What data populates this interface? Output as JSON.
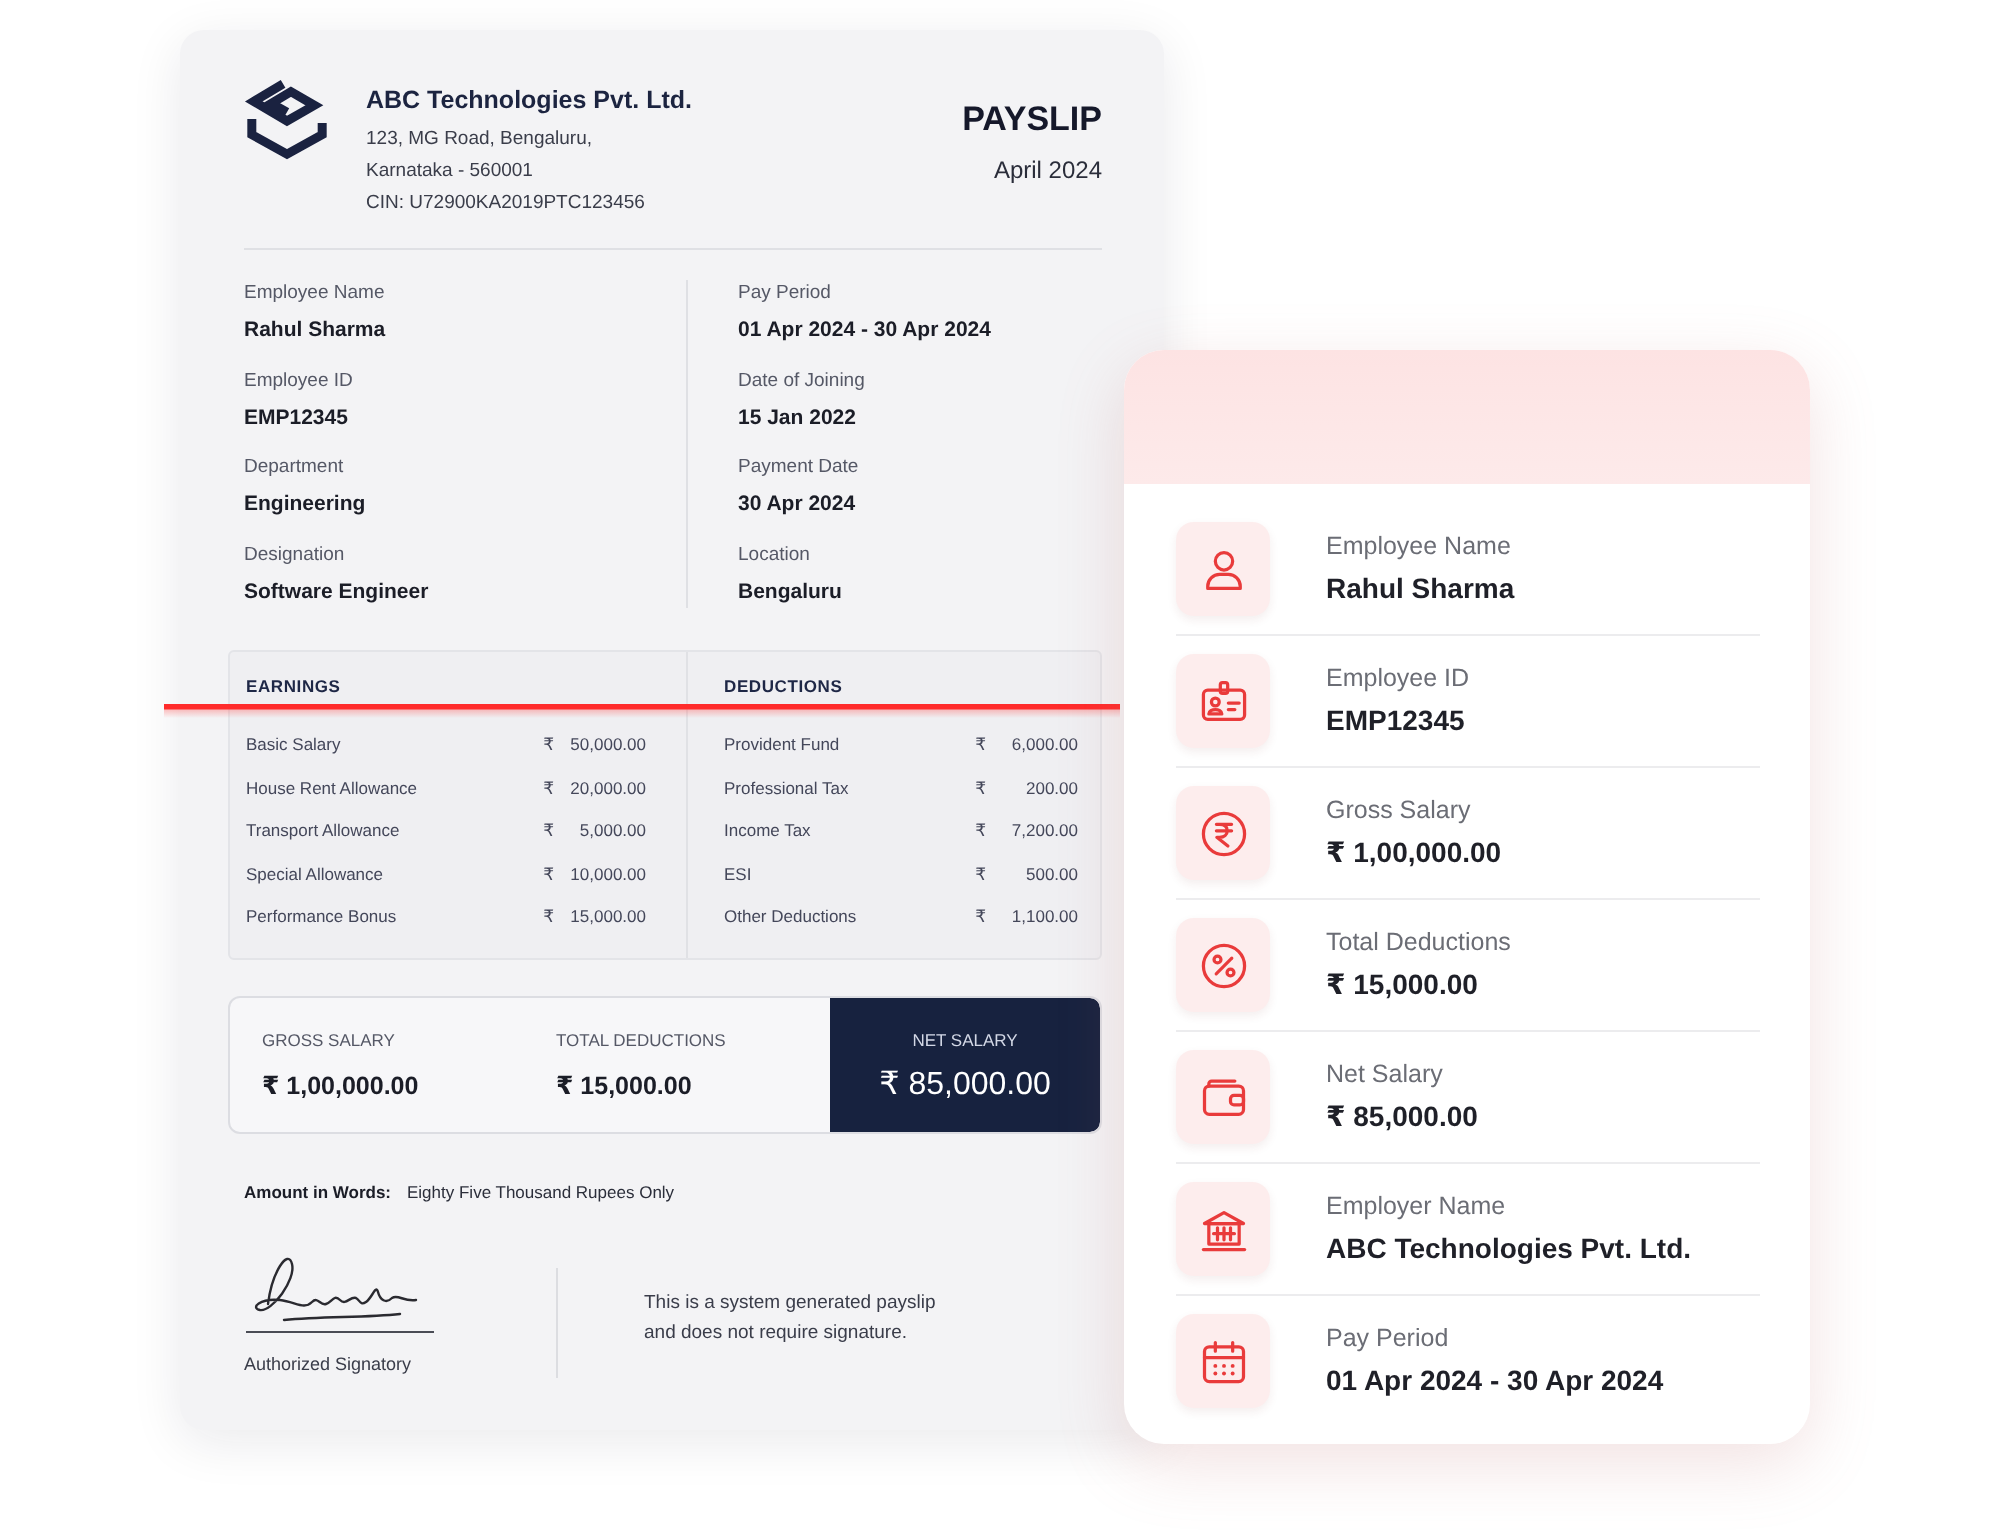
{
  "payslip": {
    "company": {
      "name": "ABC Technologies Pvt. Ltd.",
      "address_lines": [
        "123, MG Road, Bengaluru,",
        "Karnataka - 560001"
      ],
      "cin": "CIN: U72900KA2019PTC123456"
    },
    "title": "PAYSLIP",
    "month": "April 2024",
    "employee_details": [
      {
        "label": "Employee Name",
        "value": "Rahul Sharma"
      },
      {
        "label": "Employee ID",
        "value": "EMP12345"
      },
      {
        "label": "Department",
        "value": "Engineering"
      },
      {
        "label": "Designation",
        "value": "Software Engineer"
      }
    ],
    "pay_details": [
      {
        "label": "Pay Period",
        "value": "01 Apr 2024 - 30 Apr 2024"
      },
      {
        "label": "Date of Joining",
        "value": "15 Jan 2022"
      },
      {
        "label": "Payment Date",
        "value": "30 Apr 2024"
      },
      {
        "label": "Location",
        "value": "Bengaluru"
      }
    ],
    "earnings": {
      "heading": "EARNINGS",
      "rows": [
        {
          "label": "Basic Salary",
          "currency": "₹",
          "amount": "50,000.00"
        },
        {
          "label": "House Rent Allowance",
          "currency": "₹",
          "amount": "20,000.00"
        },
        {
          "label": "Transport Allowance",
          "currency": "₹",
          "amount": "5,000.00"
        },
        {
          "label": "Special Allowance",
          "currency": "₹",
          "amount": "10,000.00"
        },
        {
          "label": "Performance Bonus",
          "currency": "₹",
          "amount": "15,000.00"
        }
      ]
    },
    "deductions": {
      "heading": "DEDUCTIONS",
      "rows": [
        {
          "label": "Provident Fund",
          "currency": "₹",
          "amount": "6,000.00"
        },
        {
          "label": "Professional Tax",
          "currency": "₹",
          "amount": "200.00"
        },
        {
          "label": "Income Tax",
          "currency": "₹",
          "amount": "7,200.00"
        },
        {
          "label": "ESI",
          "currency": "₹",
          "amount": "500.00"
        },
        {
          "label": "Other Deductions",
          "currency": "₹",
          "amount": "1,100.00"
        }
      ]
    },
    "totals": [
      {
        "kind": "plain",
        "label": "GROSS SALARY",
        "value": "₹ 1,00,000.00"
      },
      {
        "kind": "plain",
        "label": "TOTAL DEDUCTIONS",
        "value": "₹ 15,000.00"
      },
      {
        "kind": "net",
        "label": "NET SALARY",
        "value": "₹ 85,000.00"
      }
    ],
    "amount_in_words": {
      "label": "Amount in Words:",
      "value": "Eighty Five Thousand Rupees Only"
    },
    "signatory": "Authorized Signatory",
    "disclaimer": "This is a system generated payslip and does not require signature."
  },
  "summary_card": {
    "items": [
      {
        "label": "Employee Name",
        "value": "Rahul Sharma"
      },
      {
        "label": "Employee ID",
        "value": "EMP12345"
      },
      {
        "label": "Gross Salary",
        "value": "₹ 1,00,000.00"
      },
      {
        "label": "Total Deductions",
        "value": "₹ 15,000.00"
      },
      {
        "label": "Net Salary",
        "value": "₹ 85,000.00"
      },
      {
        "label": "Employer Name",
        "value": "ABC Technologies Pvt. Ltd."
      },
      {
        "label": "Pay Period",
        "value": "01 Apr 2024 - 30 Apr 2024"
      }
    ]
  }
}
